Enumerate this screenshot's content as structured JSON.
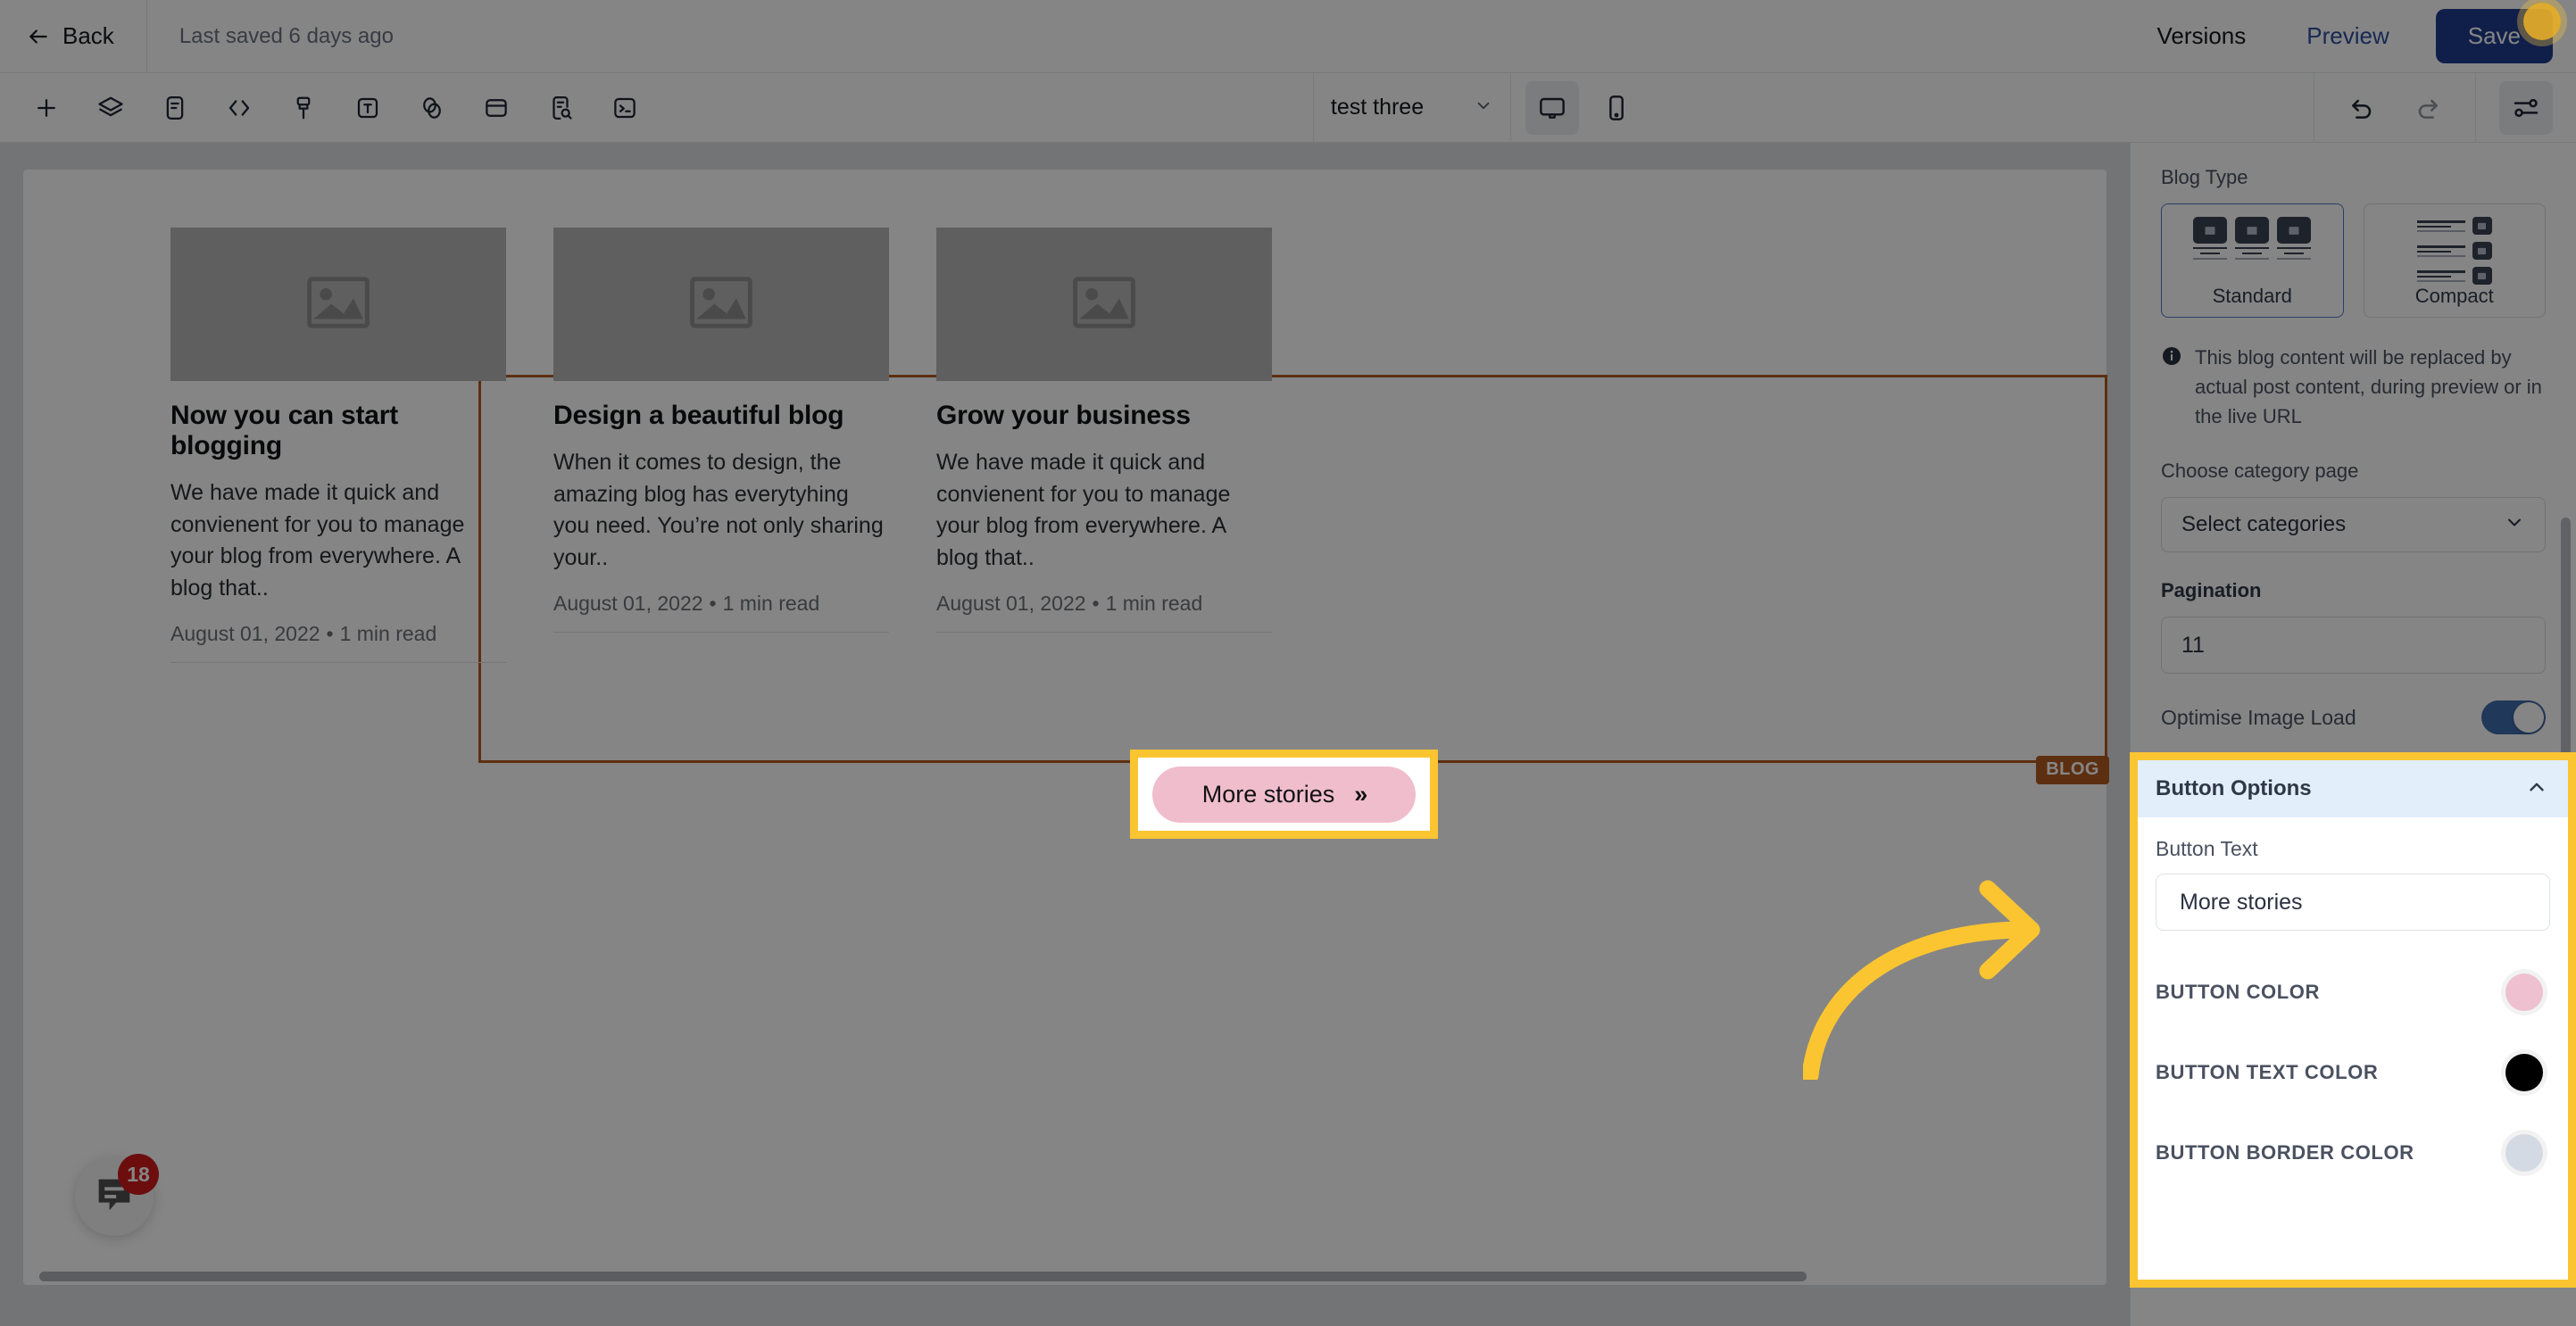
{
  "topbar": {
    "back_label": "Back",
    "back_icon": "arrow-left-icon",
    "last_saved": "Last saved 6 days ago",
    "versions_label": "Versions",
    "preview_label": "Preview",
    "save_label": "Save"
  },
  "toolbar": {
    "tools": [
      {
        "name": "add-icon",
        "title": "Add"
      },
      {
        "name": "layers-icon",
        "title": "Layers"
      },
      {
        "name": "pages-icon",
        "title": "Pages"
      },
      {
        "name": "code-icon",
        "title": "Code"
      },
      {
        "name": "brush-icon",
        "title": "Theme"
      },
      {
        "name": "text-icon",
        "title": "Typography"
      },
      {
        "name": "colors-icon",
        "title": "Colors"
      },
      {
        "name": "layout-icon",
        "title": "Layout"
      },
      {
        "name": "seo-icon",
        "title": "SEO"
      },
      {
        "name": "terminal-icon",
        "title": "Console"
      }
    ],
    "page_selected": "test three",
    "desktop_icon": "desktop-icon",
    "mobile_icon": "mobile-icon",
    "undo_icon": "undo-icon",
    "redo_icon": "redo-icon",
    "settings_icon": "sliders-icon"
  },
  "canvas": {
    "section_badge": "BLOG",
    "cards": [
      {
        "title": "Now you can start blogging",
        "desc": "We have made it quick and convienent for you to manage your blog from everywhere. A blog that..",
        "date": "August 01, 2022",
        "read_time": "1 min read",
        "thumb_icon": "image-placeholder-icon"
      },
      {
        "title": "Design a beautiful blog",
        "desc": "When it comes to design, the amazing blog has everytyhing you need. You’re not only sharing your..",
        "date": "August 01, 2022",
        "read_time": "1 min read",
        "thumb_icon": "image-placeholder-icon"
      },
      {
        "title": "Grow your business",
        "desc": "We have made it quick and convienent for you to manage your blog from everywhere. A blog that..",
        "date": "August 01, 2022",
        "read_time": "1 min read",
        "thumb_icon": "image-placeholder-icon"
      }
    ],
    "more_button_label": "More stories",
    "more_button_icon": "double-chevron-right-icon",
    "chat_badge_count": "18",
    "chat_icon": "chat-bubble-icon"
  },
  "panel": {
    "blog_type_label": "Blog Type",
    "blog_types": [
      {
        "name": "Standard",
        "selected": true
      },
      {
        "name": "Compact",
        "selected": false
      }
    ],
    "info_icon": "info-icon",
    "info_text": "This blog content will be replaced by actual post content, during preview or in the live URL",
    "category_label": "Choose category page",
    "category_value": "Select categories",
    "category_chevron": "chevron-down-icon",
    "pagination_label": "Pagination",
    "pagination_value": "11",
    "optimise_label": "Optimise Image Load",
    "optimise_on": true,
    "button_options": {
      "title": "Button Options",
      "collapse_icon": "chevron-up-icon",
      "button_text_label": "Button Text",
      "button_text_value": "More stories",
      "colors": [
        {
          "label": "BUTTON COLOR",
          "value": "#eec0d0"
        },
        {
          "label": "BUTTON TEXT COLOR",
          "value": "#000000"
        },
        {
          "label": "BUTTON BORDER COLOR",
          "value": "#d4dae3"
        }
      ]
    }
  },
  "annotations": {
    "highlight_color": "#fbc531",
    "arrow_icon": "curved-arrow-right-icon",
    "section_outline_color": "#b25a22"
  }
}
